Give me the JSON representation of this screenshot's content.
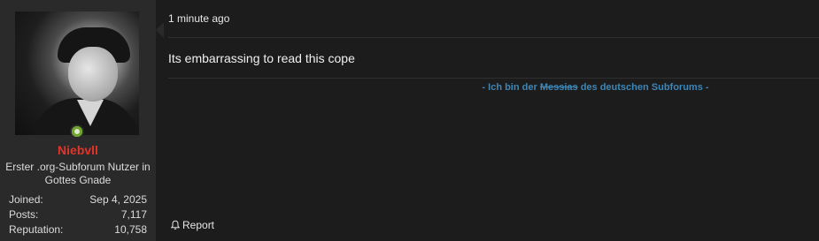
{
  "post": {
    "user": {
      "name": "Niebvll",
      "title": "Erster .org-Subforum Nutzer in Gottes Gnade",
      "online_status_color": "#6fa42c",
      "name_color": "#e0352b",
      "stats": [
        {
          "label": "Joined:",
          "value": "Sep 4, 2025"
        },
        {
          "label": "Posts:",
          "value": "7,117"
        },
        {
          "label": "Reputation:",
          "value": "10,758"
        }
      ]
    },
    "timestamp": "1 minute ago",
    "message": "Its embarrassing to read this cope",
    "signature": {
      "prefix": "- Ich bin der ",
      "struck": "Messias",
      "suffix": " des deutschen Subforums -",
      "color": "#3c86b8"
    },
    "actions": {
      "report_label": "Report",
      "report_icon": "bell-icon"
    }
  }
}
